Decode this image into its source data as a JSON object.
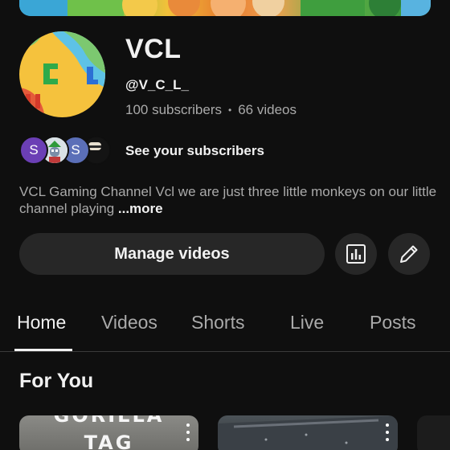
{
  "channel": {
    "name": "VCL",
    "handle": "@V_C_L_",
    "subscribers": "100 subscribers",
    "separator": "•",
    "videos": "66 videos"
  },
  "subscribers_row": {
    "avatars": [
      "S",
      "",
      "S",
      ""
    ],
    "label": "See your subscribers"
  },
  "description": {
    "text": "VCL Gaming Channel  Vcl we are just three little monkeys on our little channel playing",
    "more": "...more"
  },
  "actions": {
    "manage_label": "Manage videos",
    "analytics_icon": "bar-chart-icon",
    "edit_icon": "pencil-icon"
  },
  "tabs": [
    {
      "label": "Home",
      "active": true
    },
    {
      "label": "Videos",
      "active": false
    },
    {
      "label": "Shorts",
      "active": false
    },
    {
      "label": "Live",
      "active": false
    },
    {
      "label": "Posts",
      "active": false
    }
  ],
  "section": {
    "title": "For You"
  },
  "thumbnails": [
    {
      "line1": "GORILLA",
      "line2": "TAG"
    },
    {},
    {}
  ],
  "colors": {
    "background": "#0f0f0f",
    "surface": "#272727",
    "text_primary": "#f1f1f1",
    "text_secondary": "#aaaaaa",
    "avatar_green": "#6fcf5a",
    "avatar_yellow": "#f2c13a"
  }
}
